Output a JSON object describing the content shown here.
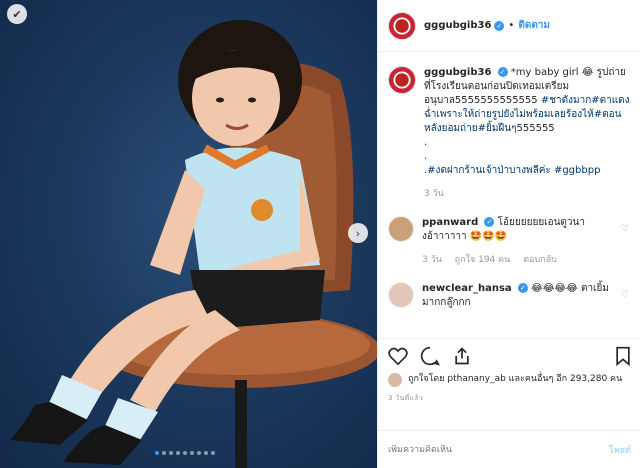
{
  "header": {
    "username": "gggubgib36",
    "separator": "•",
    "follow_label": "ติดตาม"
  },
  "caption": {
    "username": "gggubgib36",
    "text_1": "*my baby girl 😂 รูปถ่ายที่โรงเรียนตอนก่อนปิดเทอมเตรียมอนุบาล5555555555555 ",
    "hashtag_1": "#ชาดังมาก#ตาแดงฉ่ำเพราะให้ถ่ายรูปยังไม่พร้อมเลยร้องไห้#ตอนหลังยอมถ่าย#ยิ้มฝืนๆ",
    "text_2": "555555",
    "dot_lines": ".\n.",
    "hashtag_2": ".#งดฝากร้านเจ้าป่าบางพลีค่ะ #ggbbpp",
    "time": "3 วัน"
  },
  "comments": [
    {
      "username": "ppanward",
      "text": "โอ้ยยยยยยเอนดูวนางอ้าาาาาา 🤩🤩🤩",
      "time": "3 วัน",
      "likes": "ถูกใจ 194 คน",
      "reply": "ตอบกลับ",
      "avatar_color": "#c9a07a"
    },
    {
      "username": "newclear_hansa",
      "text": "😂😂😂😂 ตาเยิ้มมากกลู๊กกก",
      "avatar_color": "#e2c7b8"
    }
  ],
  "actions": {
    "likes_text": "ถูกใจโดย pthanany_ab และคนอื่นๆ อีก 293,280 คน",
    "time_ago": "3 วันที่แล้ว"
  },
  "add_comment": {
    "placeholder": "เพิ่มความคิดเห็น",
    "post_label": "โพสต์"
  },
  "photo": {
    "dots_count": 9,
    "active_dot": 1
  }
}
